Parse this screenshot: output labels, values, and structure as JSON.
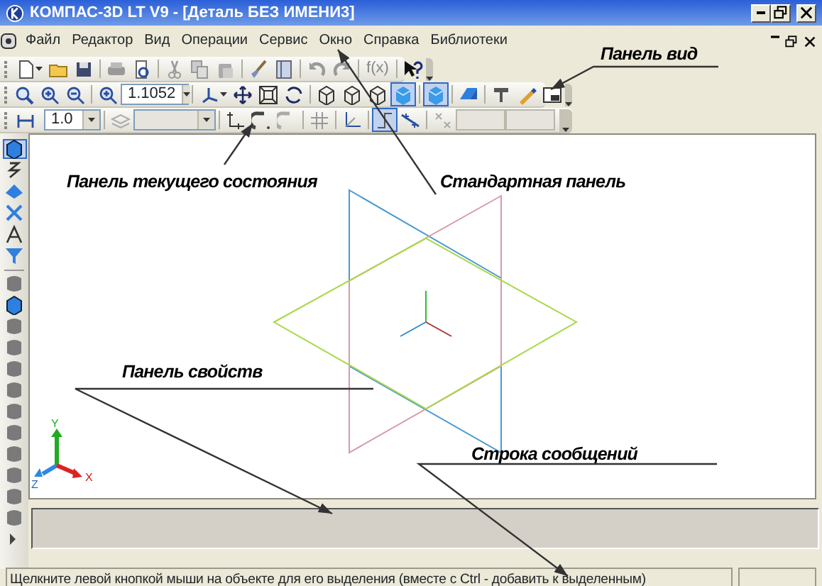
{
  "window": {
    "title": "КОМПАС-3D LT V9 - [Деталь БЕЗ ИМЕНИ3]"
  },
  "menu": [
    "Файл",
    "Редактор",
    "Вид",
    "Операции",
    "Сервис",
    "Окно",
    "Справка",
    "Библиотеки"
  ],
  "standard_toolbar": {
    "formula": "f(x)"
  },
  "view_toolbar": {
    "zoom_value": "1.1052",
    "buttons": [
      {
        "pressed": false
      },
      {
        "pressed": false
      },
      {
        "pressed": false
      },
      {
        "pressed": false
      },
      {
        "pressed": false
      },
      {
        "pressed": false
      },
      {
        "pressed": false
      },
      {
        "pressed": false
      },
      {
        "pressed": false
      },
      {
        "pressed": false
      },
      {
        "pressed": false
      },
      {
        "pressed": true
      },
      {
        "pressed": true
      },
      {
        "pressed": false
      },
      {
        "pressed": false
      },
      {
        "pressed": false
      },
      {
        "pressed": false
      }
    ]
  },
  "state_toolbar": {
    "step_value": "1.0",
    "buttons": [
      {
        "pressed": false
      },
      {
        "pressed": false
      },
      {
        "pressed": false
      },
      {
        "pressed": false
      },
      {
        "pressed": false
      },
      {
        "pressed": false
      },
      {
        "pressed": false
      },
      {
        "pressed": true
      },
      {
        "pressed": false
      }
    ]
  },
  "side_toolbar": {
    "buttons": [
      {
        "pressed": true
      },
      {
        "pressed": false
      },
      {
        "pressed": false
      },
      {
        "pressed": false
      },
      {
        "pressed": false
      },
      {
        "pressed": false
      },
      {
        "pressed": false
      },
      {
        "pressed": false
      },
      {
        "pressed": false
      },
      {
        "pressed": false
      },
      {
        "pressed": false
      },
      {
        "pressed": false
      },
      {
        "pressed": false
      },
      {
        "pressed": false
      },
      {
        "pressed": false
      },
      {
        "pressed": false
      },
      {
        "pressed": false
      },
      {
        "pressed": false
      },
      {
        "pressed": false
      }
    ]
  },
  "axis_labels": [
    "Y",
    "Z",
    "X"
  ],
  "annotations": [
    {
      "text": "Панель вид"
    },
    {
      "text": "Панель текущего состояния"
    },
    {
      "text": "Стандартная панель"
    },
    {
      "text": "Панель свойств"
    },
    {
      "text": "Строка сообщений"
    }
  ],
  "status_bar": {
    "message": "Щелкните левой кнопкой мыши на объекте для его выделения (вместе с Ctrl - добавить к выделенным)"
  }
}
